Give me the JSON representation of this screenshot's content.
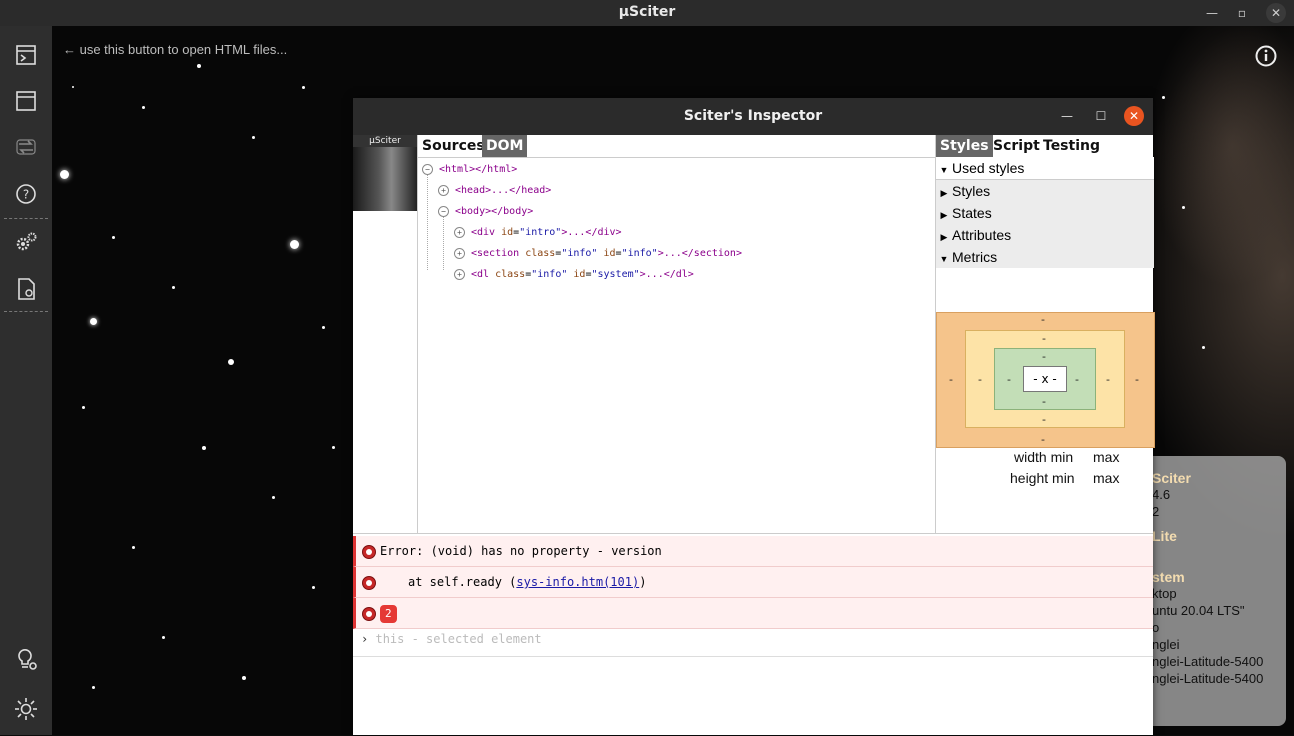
{
  "window": {
    "title": "μSciter"
  },
  "hint": "← use this button to open HTML files...",
  "sidebar": {
    "items": [
      {
        "icon": "open-file-icon"
      },
      {
        "icon": "window-icon"
      },
      {
        "icon": "reload-icon"
      },
      {
        "icon": "help-icon"
      },
      {
        "icon": "settings-icon"
      },
      {
        "icon": "document-refresh-icon"
      },
      {
        "icon": "lightbulb-settings-icon"
      },
      {
        "icon": "theme-sun-icon"
      }
    ]
  },
  "sysinfo": {
    "lines": [
      "Sciter",
      "4.6",
      "2",
      "Lite",
      "stem",
      "ktop",
      "untu 20.04 LTS\"",
      "o",
      "nglei",
      "nglei-Latitude-5400",
      "nglei-Latitude-5400"
    ]
  },
  "inspector": {
    "title": "Sciter's Inspector",
    "thumb_label": "μSciter",
    "left_tabs": [
      "Sources",
      "DOM"
    ],
    "right_tabs": [
      "Styles",
      "Script",
      "Testing"
    ],
    "dom": {
      "html": "<html></html>",
      "head": "<head>...</head>",
      "body": "<body></body>",
      "div": {
        "open": "<div ",
        "attr1": "id",
        "val1": "\"intro\"",
        "close": ">...</div>"
      },
      "section": {
        "open": "<section ",
        "attr1": "class",
        "val1": "\"info\"",
        "attr2": "id",
        "val2": "\"info\"",
        "close": ">...</section>"
      },
      "dl": {
        "open": "<dl ",
        "attr1": "class",
        "val1": "\"info\"",
        "attr2": "id",
        "val2": "\"system\"",
        "close": ">...</dl>"
      }
    },
    "sections": [
      "Used styles",
      "Styles",
      "States",
      "Attributes",
      "Metrics"
    ],
    "boxmodel": {
      "dash": "-",
      "center": "- x -"
    },
    "sizes": {
      "width_min": "width min",
      "width_max": "max",
      "height_min": "height min",
      "height_max": "max"
    },
    "console": {
      "error": "Error: (void) has no property - version",
      "at_prefix": "at self.ready (",
      "at_link": "sys-info.htm(101)",
      "at_suffix": ")",
      "count": "2",
      "prompt": "›",
      "placeholder": "this - selected element"
    }
  }
}
